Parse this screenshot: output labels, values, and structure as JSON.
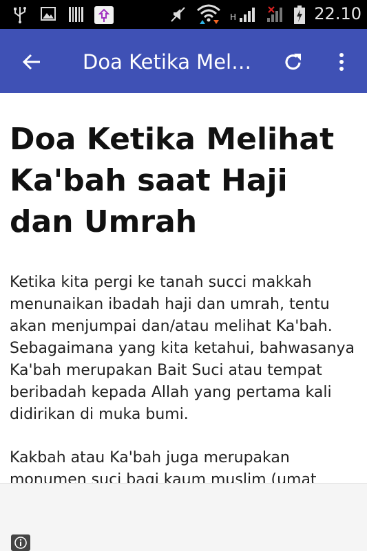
{
  "status_bar": {
    "time": "22.10",
    "network_label": "H",
    "icons": [
      "usb-icon",
      "image-icon",
      "barcode-icon",
      "app-notification-icon",
      "mute-icon",
      "wifi-icon",
      "signal-icon",
      "signal-x-icon",
      "battery-charging-icon"
    ]
  },
  "app_bar": {
    "title": "Doa Ketika Mel…",
    "back_icon": "arrow-back-icon",
    "refresh_icon": "refresh-icon",
    "more_icon": "more-vert-icon",
    "color": "#3f51b5"
  },
  "article": {
    "title": "Doa Ketika Melihat Ka'bah saat Haji dan Umrah",
    "paragraphs": [
      "Ketika kita pergi ke tanah succi makkah menunaikan ibadah haji dan umrah, tentu akan menjumpai dan/atau melihat Ka'bah. Sebagaimana yang kita ketahui, bahwasanya Ka'bah merupakan Bait Suci atau tempat beribadah kepada Allah yang pertama kali didirikan di muka bumi.",
      "Kakbah atau Ka'bah juga merupakan monumen suci bagi kaum muslim (umat"
    ]
  },
  "ad": {
    "info_icon": "info-icon"
  }
}
